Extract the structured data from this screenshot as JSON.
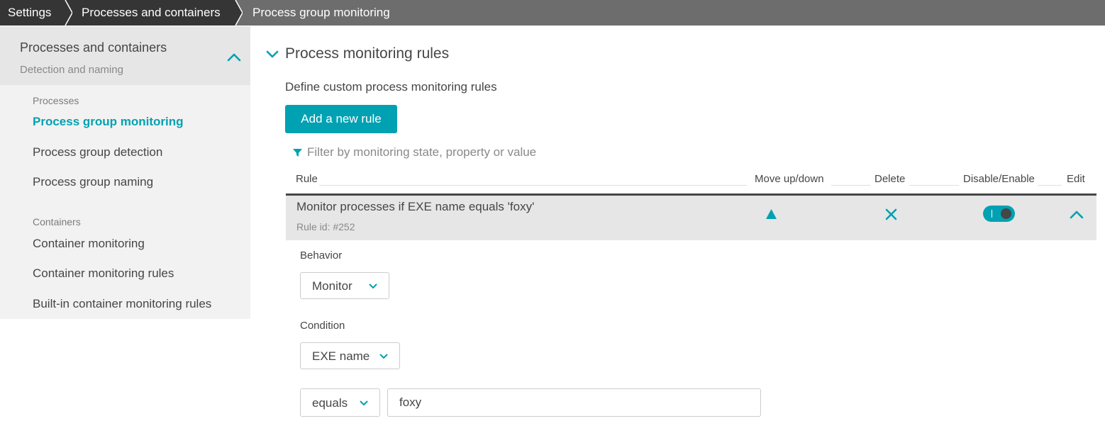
{
  "breadcrumb": {
    "items": [
      "Settings",
      "Processes and containers",
      "Process group monitoring"
    ]
  },
  "sidebar": {
    "title": "Processes and containers",
    "subtitle": "Detection and naming",
    "groups": [
      {
        "label": "Processes",
        "items": [
          {
            "label": "Process group monitoring",
            "active": true
          },
          {
            "label": "Process group detection",
            "active": false
          },
          {
            "label": "Process group naming",
            "active": false
          }
        ]
      },
      {
        "label": "Containers",
        "items": [
          {
            "label": "Container monitoring",
            "active": false
          },
          {
            "label": "Container monitoring rules",
            "active": false
          },
          {
            "label": "Built-in container monitoring rules",
            "active": false
          }
        ]
      }
    ]
  },
  "main": {
    "section_title": "Process monitoring rules",
    "description": "Define custom process monitoring rules",
    "add_button": "Add a new rule",
    "filter_placeholder": "Filter by monitoring state, property or value",
    "columns": [
      "Rule",
      "Move up/down",
      "Delete",
      "Disable/Enable",
      "Edit"
    ],
    "rule": {
      "title": "Monitor processes if EXE name equals 'foxy'",
      "id": "Rule id: #252",
      "enabled": true
    },
    "form": {
      "behavior_label": "Behavior",
      "behavior_value": "Monitor",
      "condition_label": "Condition",
      "condition_value": "EXE name",
      "operator_value": "equals",
      "match_value": "foxy"
    }
  },
  "colors": {
    "accent": "#00a1b2",
    "breadcrumb_dark": "#353535",
    "breadcrumb_light": "#6d6d6d",
    "sidebar_bg": "#f2f2f2",
    "row_bg": "#e6e6e6"
  },
  "icons": {
    "section_toggle": "chevron-down-icon",
    "sidebar_collapse": "chevron-up-icon",
    "filter": "filter-icon",
    "move": "triangle-up-icon",
    "delete": "close-icon",
    "edit": "chevron-up-icon",
    "select": "chevron-down-icon"
  }
}
